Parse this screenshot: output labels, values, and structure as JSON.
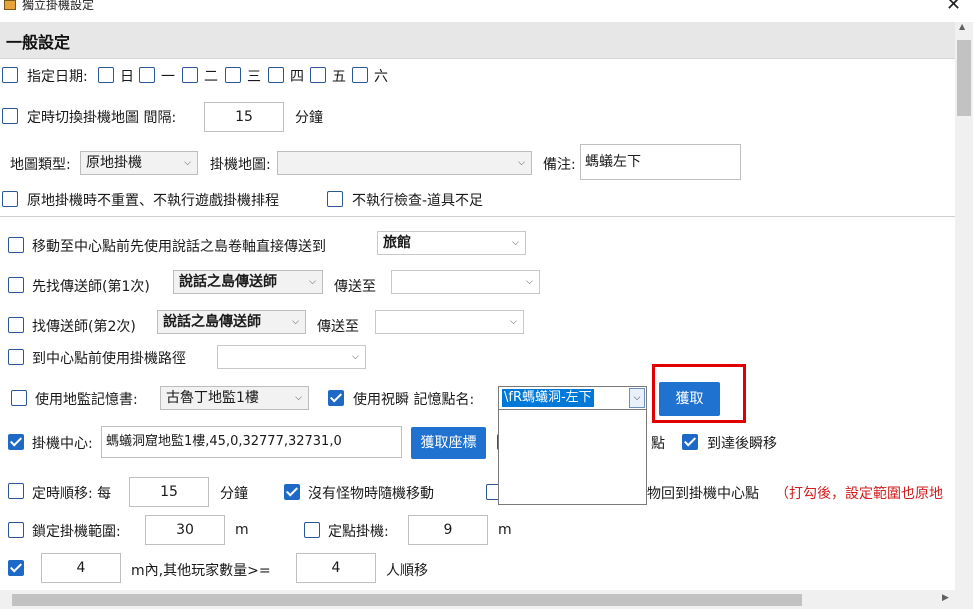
{
  "window": {
    "title": "獨立掛機設定",
    "close": "✕"
  },
  "section": {
    "title": "一般設定"
  },
  "schedule": {
    "label": "指定日期:",
    "days": [
      "日",
      "一",
      "二",
      "三",
      "四",
      "五",
      "六"
    ]
  },
  "map_switch": {
    "label": "定時切換掛機地圖 間隔:",
    "value": "15",
    "unit": "分鐘"
  },
  "map_row": {
    "type_label": "地圖類型:",
    "type_value": "原地掛機",
    "map_label": "掛機地圖:",
    "map_value": "",
    "note_label": "備注:",
    "note_value": "螞蟻左下"
  },
  "options_row": {
    "no_reset": "原地掛機時不重置、不執行遊戲掛機排程",
    "no_check": "不執行檢查-道具不足"
  },
  "teleport_scroll": {
    "label": "移動至中心點前先使用說話之島卷軸直接傳送到",
    "value": "旅館"
  },
  "find_teleporter_1": {
    "label": "先找傳送師(第1次)",
    "npc": "說話之島傳送師",
    "to_label": "傳送至",
    "to_value": ""
  },
  "find_teleporter_2": {
    "label": "找傳送師(第2次)",
    "npc": "說話之島傳送師",
    "to_label": "傳送至",
    "to_value": ""
  },
  "path_row": {
    "label": "到中心點前使用掛機路徑",
    "value": ""
  },
  "memory_row": {
    "book_label": "使用地監記憶書:",
    "book_value": "古魯丁地監1樓",
    "bless_label": "使用祝瞬 記憶點名:",
    "bless_value": "\\fR螞蟻洞-左下",
    "fetch_button": "獲取"
  },
  "center_row": {
    "label": "掛機中心:",
    "value": "螞蟻洞窟地監1樓,45,0,32777,32731,0",
    "fetch_coords_button": "獲取座標",
    "partial_label": "點",
    "after_arrive_label": "到達後瞬移"
  },
  "timer_row": {
    "label": "定時順移: 每",
    "value": "15",
    "unit": "分鐘",
    "random_move_label": "沒有怪物時隨機移動",
    "partial_label": "物回到掛機中心點",
    "note_red": "（打勾後，設定範圍也原地"
  },
  "range_row": {
    "lock_label": "鎖定掛機範圍:",
    "lock_value": "30",
    "lock_unit": "m",
    "fixed_label": "定點掛機:",
    "fixed_value": "9",
    "fixed_unit": "m"
  },
  "players_row": {
    "distance_value": "4",
    "text": "m內,其他玩家數量>=",
    "count_value": "4",
    "unit": "人順移"
  },
  "scrollbars": {
    "up": "▲",
    "right": "▶"
  },
  "icons": {
    "dropdown": "chevron-down-icon"
  }
}
